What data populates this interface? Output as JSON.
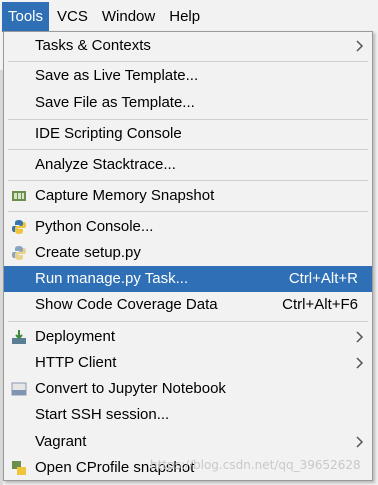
{
  "menubar": {
    "items": [
      {
        "label": "Tools"
      },
      {
        "label": "VCS"
      },
      {
        "label": "Window"
      },
      {
        "label": "Help"
      }
    ]
  },
  "menu": {
    "items": [
      {
        "label": "Tasks & Contexts",
        "submenu": true
      },
      {
        "label": "Save as Live Template..."
      },
      {
        "label": "Save File as Template..."
      },
      {
        "label": "IDE Scripting Console"
      },
      {
        "label": "Analyze Stacktrace..."
      },
      {
        "label": "Capture Memory Snapshot",
        "icon": "memory-snapshot-icon"
      },
      {
        "label": "Python Console...",
        "icon": "python-icon"
      },
      {
        "label": "Create setup.py",
        "icon": "python-icon"
      },
      {
        "label": "Run manage.py Task...",
        "shortcut": "Ctrl+Alt+R",
        "selected": true
      },
      {
        "label": "Show Code Coverage Data",
        "shortcut": "Ctrl+Alt+F6"
      },
      {
        "label": "Deployment",
        "submenu": true,
        "icon": "deployment-icon"
      },
      {
        "label": "HTTP Client",
        "submenu": true
      },
      {
        "label": "Convert to Jupyter Notebook",
        "icon": "jupyter-icon"
      },
      {
        "label": "Start SSH session..."
      },
      {
        "label": "Vagrant",
        "submenu": true
      },
      {
        "label": "Open CProfile snapshot",
        "icon": "profile-icon"
      }
    ]
  },
  "watermark": "https://blog.csdn.net/qq_39652628",
  "colors": {
    "selection": "#2e6fb5",
    "background": "#f2f2f2"
  }
}
